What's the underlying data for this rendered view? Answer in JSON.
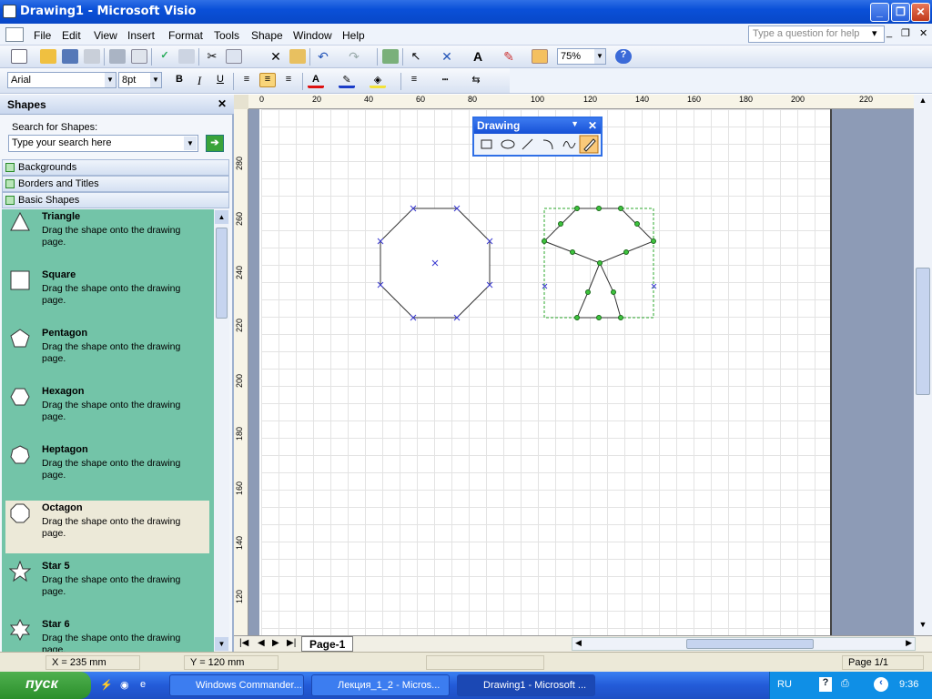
{
  "window": {
    "title": "Drawing1 - Microsoft Visio"
  },
  "menu": {
    "items": [
      "File",
      "Edit",
      "View",
      "Insert",
      "Format",
      "Tools",
      "Shape",
      "Window",
      "Help"
    ],
    "help_placeholder": "Type a question for help"
  },
  "toolbar": {
    "zoom": "75%",
    "font": "Arial",
    "font_size": "8pt"
  },
  "shapes_pane": {
    "title": "Shapes",
    "search_label": "Search for Shapes:",
    "search_placeholder": "Type your search here",
    "stencils": [
      "Backgrounds",
      "Borders and Titles",
      "Basic Shapes"
    ],
    "items": [
      {
        "name": "Triangle",
        "desc": "Drag the shape onto the drawing page."
      },
      {
        "name": "Square",
        "desc": "Drag the shape onto the drawing page."
      },
      {
        "name": "Pentagon",
        "desc": "Drag the shape onto the drawing page."
      },
      {
        "name": "Hexagon",
        "desc": "Drag the shape onto the drawing page."
      },
      {
        "name": "Heptagon",
        "desc": "Drag the shape onto the drawing page."
      },
      {
        "name": "Octagon",
        "desc": "Drag the shape onto the drawing page."
      },
      {
        "name": "Star 5",
        "desc": "Drag the shape onto the drawing page."
      },
      {
        "name": "Star 6",
        "desc": "Drag the shape onto the drawing page."
      }
    ]
  },
  "rulers": {
    "h": [
      "0",
      "20",
      "40",
      "60",
      "80",
      "100",
      "120",
      "140",
      "160",
      "180",
      "200",
      "220"
    ],
    "v": [
      "280",
      "260",
      "240",
      "220",
      "200",
      "180",
      "160",
      "140",
      "120"
    ]
  },
  "drawing_toolbar": {
    "title": "Drawing"
  },
  "page_tab": "Page-1",
  "status": {
    "x": "X = 235 mm",
    "y": "Y = 120 mm",
    "page": "Page 1/1"
  },
  "taskbar": {
    "start": "пуск",
    "tasks": [
      "Windows Commander...",
      "Лекция_1_2 - Micros...",
      "Drawing1 - Microsoft ..."
    ],
    "lang": "RU",
    "clock": "9:36"
  }
}
